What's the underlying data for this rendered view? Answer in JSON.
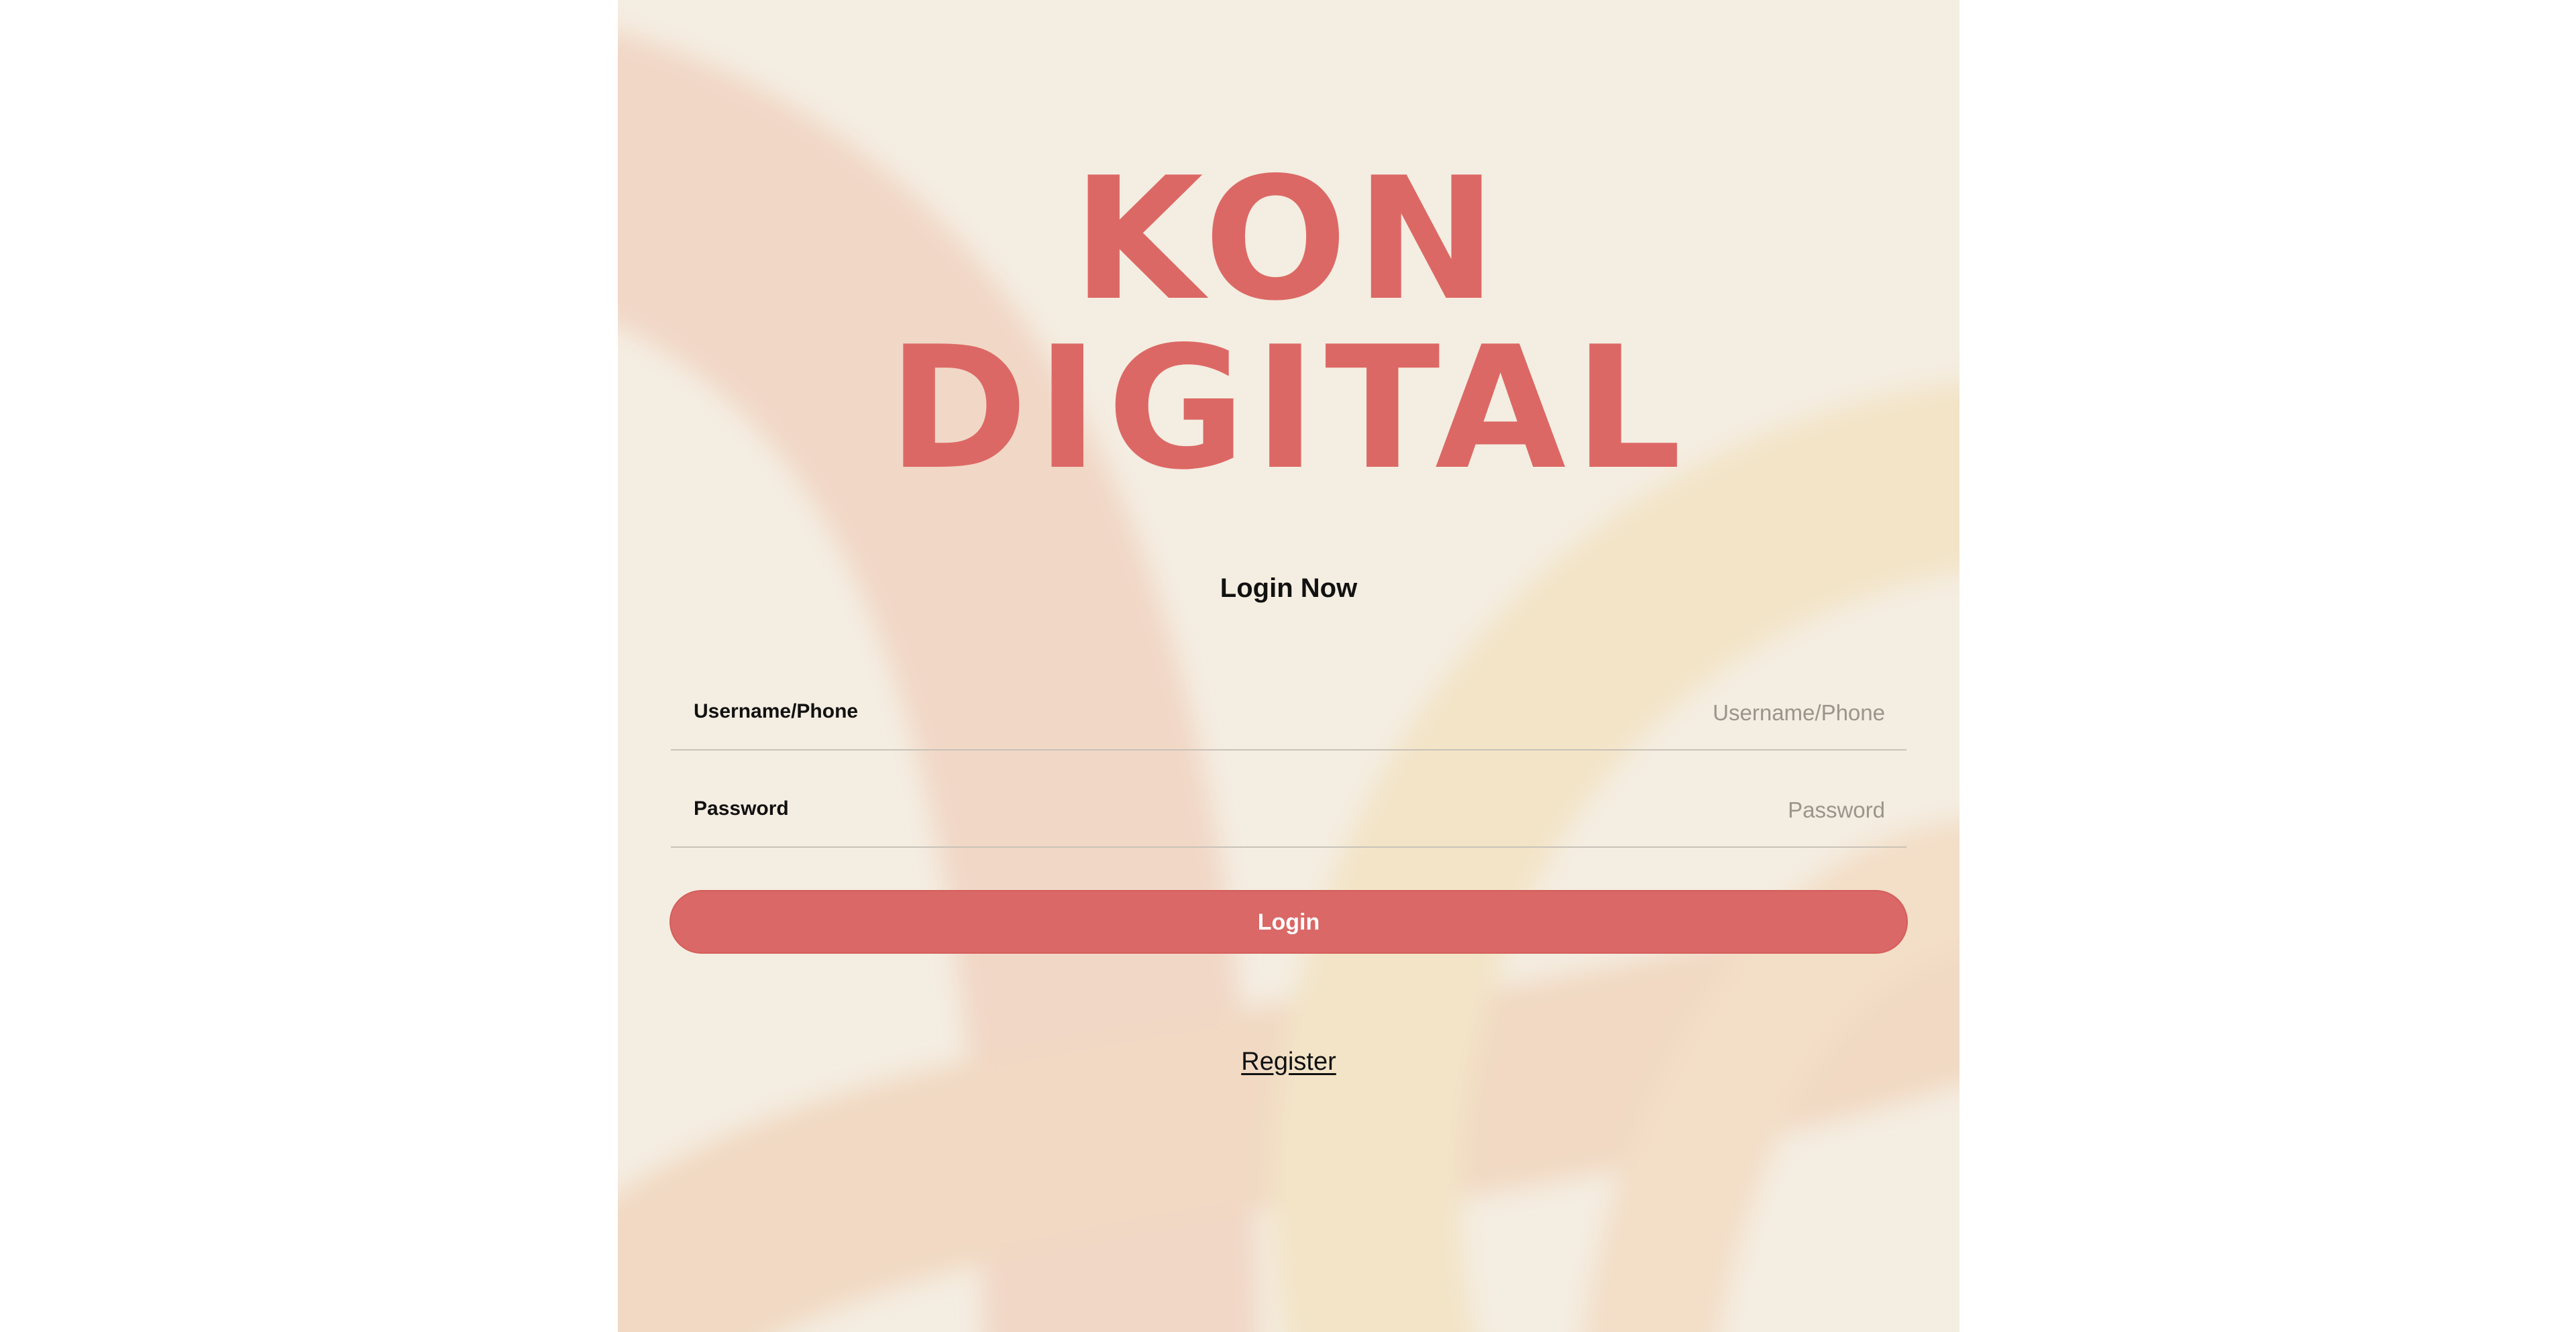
{
  "brand": {
    "line1": "KON",
    "line2": "DIGITAL",
    "color": "#dc6865"
  },
  "login": {
    "title": "Login Now",
    "username_label": "Username/Phone",
    "username_placeholder": "Username/Phone",
    "password_label": "Password",
    "password_placeholder": "Password",
    "button_label": "Login",
    "register_label": "Register"
  },
  "colors": {
    "panel_background": "#f4ede1",
    "button": "#d96866",
    "page_background": "#ffffff"
  }
}
